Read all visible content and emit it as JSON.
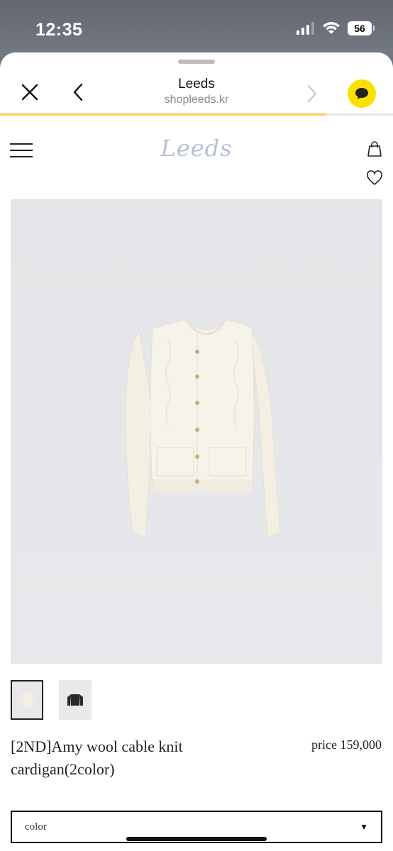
{
  "status_bar": {
    "time": "12:35",
    "battery_level": "56"
  },
  "browser": {
    "page_title": "Leeds",
    "url": "shopleeds.kr",
    "load_progress": 0.83
  },
  "site": {
    "logo_text": "Leeds"
  },
  "product": {
    "name": "[2ND]Amy wool cable knit cardigan(2color)",
    "price": "price 159,000",
    "thumbnails": [
      "ivory",
      "black"
    ],
    "color_select": {
      "label": "color"
    }
  },
  "colors": {
    "accent_yellow": "#f9e000",
    "progress": "#f4cf5a",
    "logo": "#b7bfd6"
  }
}
